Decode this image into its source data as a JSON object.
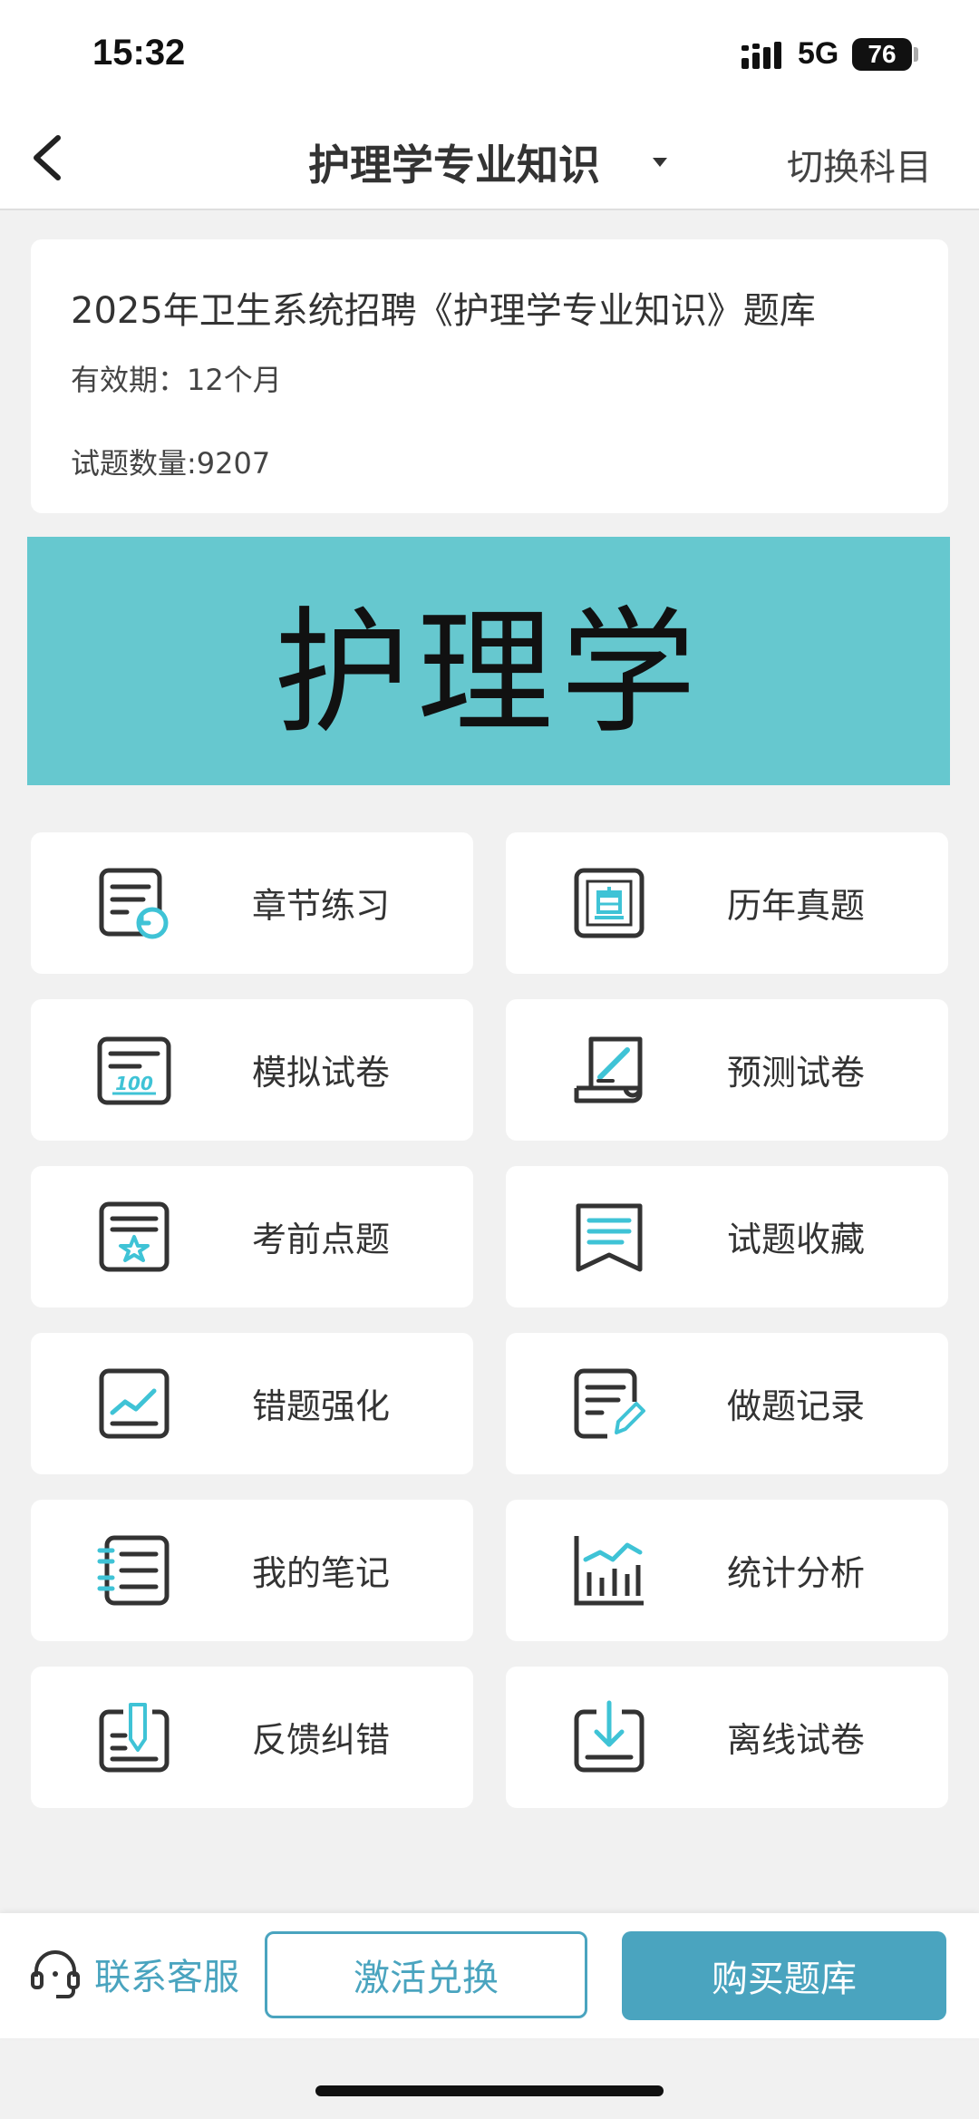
{
  "status_bar": {
    "time": "15:32",
    "network": "5G",
    "battery": "76"
  },
  "nav": {
    "title": "护理学专业知识",
    "switch_label": "切换科目",
    "icons": {
      "back": "chevron-left-icon",
      "caret": "caret-down-icon"
    }
  },
  "info": {
    "title": "2025年卫生系统招聘《护理学专业知识》题库",
    "validity": "有效期：12个月",
    "count": "试题数量:9207"
  },
  "banner": {
    "text": "护理学",
    "color": "#66c8cf"
  },
  "menu": [
    {
      "label": "章节练习",
      "icon": "chapter-practice-icon"
    },
    {
      "label": "历年真题",
      "icon": "past-exams-icon"
    },
    {
      "label": "模拟试卷",
      "icon": "mock-paper-icon"
    },
    {
      "label": "预测试卷",
      "icon": "prediction-paper-icon"
    },
    {
      "label": "考前点题",
      "icon": "pre-exam-tips-icon"
    },
    {
      "label": "试题收藏",
      "icon": "bookmark-icon"
    },
    {
      "label": "错题强化",
      "icon": "wrong-questions-icon"
    },
    {
      "label": "做题记录",
      "icon": "history-record-icon"
    },
    {
      "label": "我的笔记",
      "icon": "notebook-icon"
    },
    {
      "label": "统计分析",
      "icon": "stats-chart-icon"
    },
    {
      "label": "反馈纠错",
      "icon": "feedback-icon"
    },
    {
      "label": "离线试卷",
      "icon": "download-icon"
    }
  ],
  "bottom": {
    "service_label": "联系客服",
    "activate_label": "激活兑换",
    "buy_label": "购买题库",
    "accent_color": "#4aa4bf"
  }
}
